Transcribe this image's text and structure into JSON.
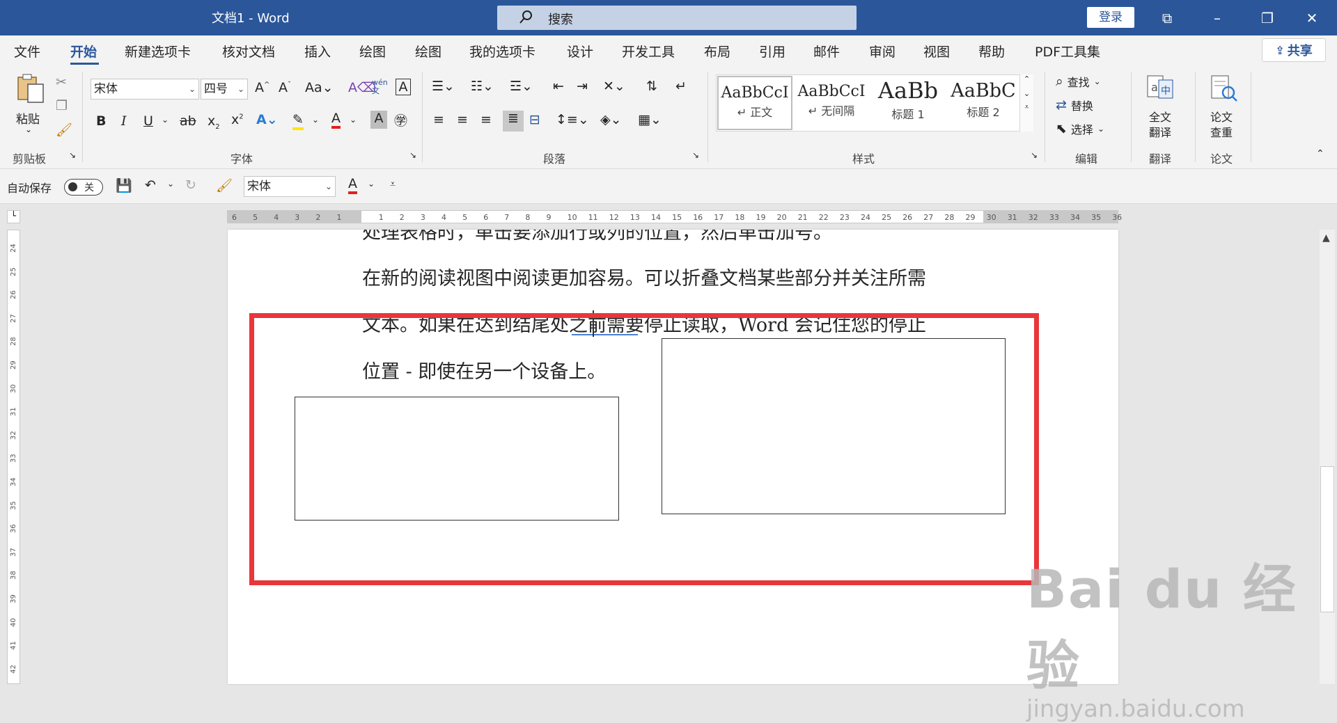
{
  "titlebar": {
    "doc_title": "文档1  -  Word",
    "search_placeholder": "搜索",
    "login": "登录",
    "controls": [
      "⧉",
      "–",
      "❐",
      "✕"
    ]
  },
  "tabs": [
    "文件",
    "开始",
    "新建选项卡",
    "核对文档",
    "插入",
    "绘图",
    "绘图",
    "我的选项卡",
    "设计",
    "开发工具",
    "布局",
    "引用",
    "邮件",
    "审阅",
    "视图",
    "帮助",
    "PDF工具集"
  ],
  "share": "共享",
  "ribbon": {
    "clipboard": {
      "paste": "粘贴",
      "label": "剪贴板"
    },
    "font": {
      "font_name": "宋体",
      "font_size": "四号",
      "label": "字体"
    },
    "paragraph": {
      "label": "段落"
    },
    "styles": {
      "label": "样式",
      "items": [
        {
          "sample": "AaBbCcI",
          "name": "↵ 正文"
        },
        {
          "sample": "AaBbCcI",
          "name": "↵ 无间隔"
        },
        {
          "sample": "AaBb",
          "name": "标题 1"
        },
        {
          "sample": "AaBbC",
          "name": "标题 2"
        }
      ]
    },
    "editing": {
      "find": "查找",
      "replace": "替换",
      "select": "选择",
      "label": "编辑"
    },
    "translate": {
      "btn_line1": "全文",
      "btn_line2": "翻译",
      "label": "翻译"
    },
    "paper": {
      "btn_line1": "论文",
      "btn_line2": "查重",
      "label": "论文"
    }
  },
  "qat": {
    "autosave": "自动保存",
    "toggle_state": "关",
    "font_name": "宋体"
  },
  "ruler": {
    "h_ticks": [
      "6",
      "5",
      "4",
      "3",
      "2",
      "1",
      "",
      "1",
      "2",
      "3",
      "4",
      "5",
      "6",
      "7",
      "8",
      "9",
      "10",
      "11",
      "12",
      "13",
      "14",
      "15",
      "16",
      "17",
      "18",
      "19",
      "20",
      "21",
      "22",
      "23",
      "24",
      "25",
      "26",
      "27",
      "28",
      "29",
      "30",
      "31",
      "32",
      "33",
      "34",
      "35",
      "36"
    ],
    "v_ticks": [
      "24",
      "25",
      "26",
      "27",
      "28",
      "29",
      "30",
      "31",
      "32",
      "33",
      "34",
      "35",
      "36",
      "37",
      "38",
      "39",
      "40",
      "41",
      "42"
    ]
  },
  "document": {
    "lines": [
      "处理表格时，单击要添加行或列的位置，然后单击加号。",
      "在新的阅读视图中阅读更加容易。可以折叠文档某些部分并关注所需",
      "文本。如果在达到结尾处之前需要停止读取，Word 会记住您的停止",
      "位置 - 即使在另一个设备上。"
    ]
  },
  "watermark": {
    "logo": "Bai du 经验",
    "url": "jingyan.baidu.com"
  },
  "colors": {
    "brand": "#2b579a",
    "highlight_box": "#e8363b"
  }
}
